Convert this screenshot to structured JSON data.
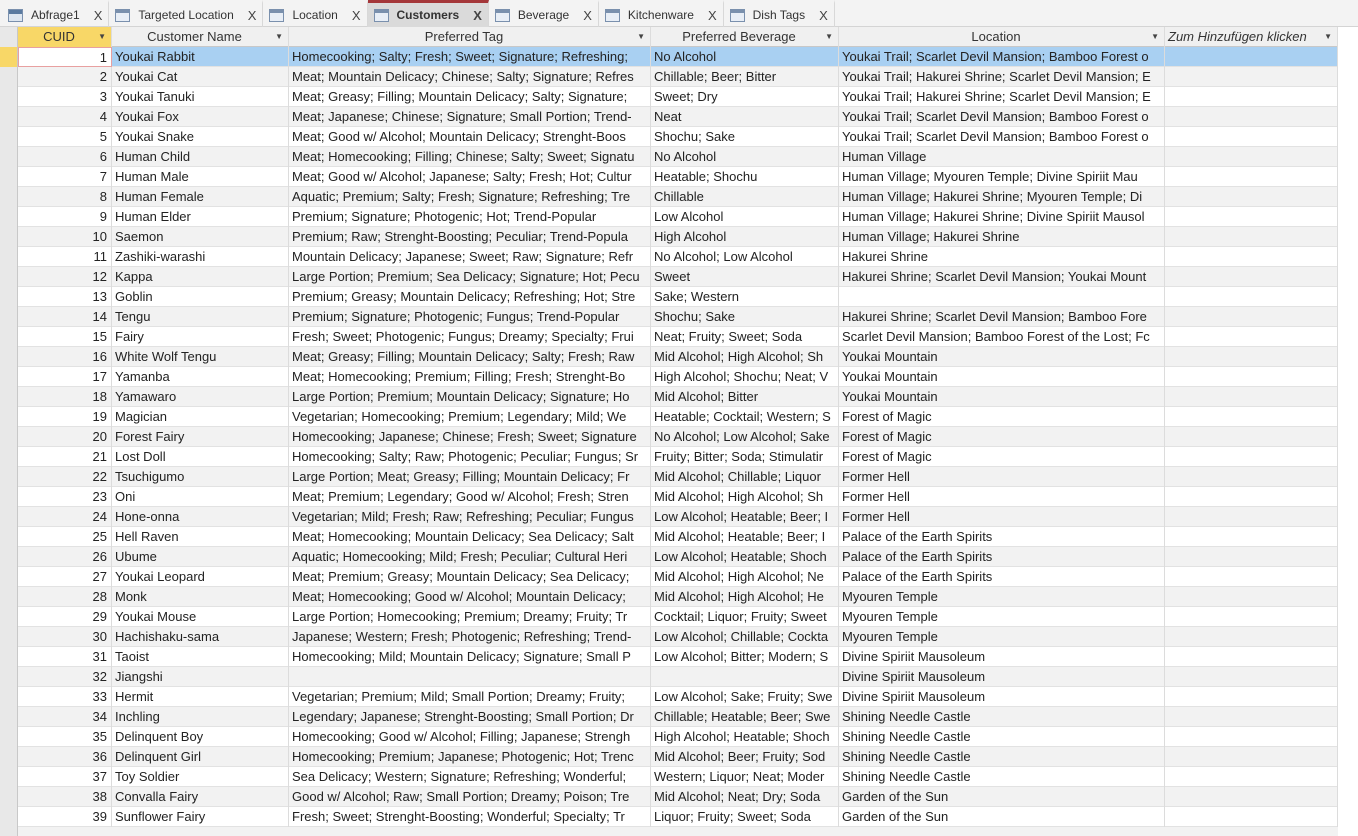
{
  "tabs": [
    {
      "label": "Abfrage1",
      "icon": "query-icon",
      "active": false
    },
    {
      "label": "Targeted Location",
      "icon": "table-icon",
      "active": false
    },
    {
      "label": "Location",
      "icon": "table-icon",
      "active": false
    },
    {
      "label": "Customers",
      "icon": "table-icon",
      "active": true
    },
    {
      "label": "Beverage",
      "icon": "table-icon",
      "active": false
    },
    {
      "label": "Kitchenware",
      "icon": "table-icon",
      "active": false
    },
    {
      "label": "Dish Tags",
      "icon": "table-icon",
      "active": false
    }
  ],
  "close_glyph": "X",
  "columns": [
    "CUID",
    "Customer Name",
    "Preferred Tag",
    "Preferred Beverage",
    "Location",
    "Zum Hinzufügen klicken"
  ],
  "colors": {
    "selected_row": "#a9d0f2",
    "active_header": "#f8d767",
    "active_tab_border": "#a4373a"
  },
  "rows": [
    [
      "1",
      "Youkai Rabbit",
      "Homecooking; Salty; Fresh; Sweet; Signature; Refreshing;",
      "No Alcohol",
      "Youkai Trail; Scarlet Devil Mansion; Bamboo Forest o"
    ],
    [
      "2",
      "Youkai Cat",
      "Meat; Mountain Delicacy; Chinese; Salty; Signature; Refres",
      "Chillable; Beer; Bitter",
      "Youkai Trail; Hakurei Shrine; Scarlet Devil Mansion; E"
    ],
    [
      "3",
      "Youkai Tanuki",
      "Meat; Greasy; Filling; Mountain Delicacy; Salty; Signature;",
      "Sweet; Dry",
      "Youkai Trail; Hakurei Shrine; Scarlet Devil Mansion; E"
    ],
    [
      "4",
      "Youkai Fox",
      "Meat; Japanese; Chinese; Signature; Small Portion; Trend-",
      "Neat",
      "Youkai Trail; Scarlet Devil Mansion; Bamboo Forest o"
    ],
    [
      "5",
      "Youkai Snake",
      "Meat; Good w/ Alcohol; Mountain Delicacy; Strenght-Boos",
      "Shochu; Sake",
      "Youkai Trail; Scarlet Devil Mansion; Bamboo Forest o"
    ],
    [
      "6",
      "Human Child",
      "Meat; Homecooking; Filling; Chinese; Salty; Sweet; Signatu",
      "No Alcohol",
      "Human Village"
    ],
    [
      "7",
      "Human Male",
      "Meat; Good w/ Alcohol; Japanese; Salty; Fresh; Hot; Cultur",
      "Heatable; Shochu",
      "Human Village; Myouren Temple; Divine Spiriit Mau"
    ],
    [
      "8",
      "Human Female",
      "Aquatic; Premium; Salty; Fresh; Signature; Refreshing; Tre",
      "Chillable",
      "Human Village; Hakurei Shrine; Myouren Temple; Di"
    ],
    [
      "9",
      "Human Elder",
      "Premium; Signature; Photogenic; Hot; Trend-Popular",
      "Low Alcohol",
      "Human Village; Hakurei Shrine; Divine Spiriit Mausol"
    ],
    [
      "10",
      "Saemon",
      "Premium; Raw; Strenght-Boosting; Peculiar; Trend-Popula",
      "High Alcohol",
      "Human Village; Hakurei Shrine"
    ],
    [
      "11",
      "Zashiki-warashi",
      "Mountain Delicacy; Japanese; Sweet; Raw; Signature; Refr",
      "No Alcohol; Low Alcohol",
      "Hakurei Shrine"
    ],
    [
      "12",
      "Kappa",
      "Large Portion; Premium; Sea Delicacy; Signature; Hot; Pecu",
      "Sweet",
      "Hakurei Shrine; Scarlet Devil Mansion; Youkai Mount"
    ],
    [
      "13",
      "Goblin",
      "Premium; Greasy; Mountain Delicacy; Refreshing; Hot; Stre",
      "Sake; Western",
      ""
    ],
    [
      "14",
      "Tengu",
      "Premium; Signature; Photogenic; Fungus; Trend-Popular",
      "Shochu; Sake",
      "Hakurei Shrine; Scarlet Devil Mansion; Bamboo Fore"
    ],
    [
      "15",
      "Fairy",
      "Fresh; Sweet; Photogenic; Fungus; Dreamy; Specialty; Frui",
      "Neat; Fruity; Sweet; Soda",
      "Scarlet Devil Mansion; Bamboo Forest of the Lost; Fc"
    ],
    [
      "16",
      "White Wolf Tengu",
      "Meat; Greasy; Filling; Mountain Delicacy; Salty; Fresh; Raw",
      "Mid Alcohol; High Alcohol; Sh",
      "Youkai Mountain"
    ],
    [
      "17",
      "Yamanba",
      "Meat; Homecooking; Premium; Filling; Fresh; Strenght-Bo",
      "High Alcohol; Shochu; Neat; V",
      "Youkai Mountain"
    ],
    [
      "18",
      "Yamawaro",
      "Large Portion; Premium; Mountain Delicacy; Signature; Ho",
      "Mid Alcohol; Bitter",
      "Youkai Mountain"
    ],
    [
      "19",
      "Magician",
      "Vegetarian; Homecooking; Premium; Legendary; Mild; We",
      "Heatable; Cocktail; Western; S",
      "Forest of Magic"
    ],
    [
      "20",
      "Forest Fairy",
      "Homecooking; Japanese; Chinese; Fresh; Sweet; Signature",
      "No Alcohol; Low Alcohol; Sake",
      "Forest of Magic"
    ],
    [
      "21",
      "Lost Doll",
      "Homecooking; Salty; Raw; Photogenic; Peculiar; Fungus; Sr",
      "Fruity; Bitter; Soda; Stimulatir",
      "Forest of Magic"
    ],
    [
      "22",
      "Tsuchigumo",
      "Large Portion; Meat; Greasy; Filling; Mountain Delicacy; Fr",
      "Mid Alcohol; Chillable; Liquor",
      "Former Hell"
    ],
    [
      "23",
      "Oni",
      "Meat; Premium; Legendary; Good w/ Alcohol; Fresh; Stren",
      "Mid Alcohol; High Alcohol; Sh",
      "Former Hell"
    ],
    [
      "24",
      "Hone-onna",
      "Vegetarian; Mild; Fresh; Raw; Refreshing; Peculiar; Fungus",
      "Low Alcohol; Heatable; Beer; I",
      "Former Hell"
    ],
    [
      "25",
      "Hell Raven",
      "Meat; Homecooking; Mountain Delicacy; Sea Delicacy; Salt",
      "Mid Alcohol; Heatable; Beer; I",
      "Palace of the Earth Spirits"
    ],
    [
      "26",
      "Ubume",
      "Aquatic; Homecooking; Mild; Fresh; Peculiar; Cultural Heri",
      "Low Alcohol; Heatable; Shoch",
      "Palace of the Earth Spirits"
    ],
    [
      "27",
      "Youkai Leopard",
      "Meat; Premium; Greasy; Mountain Delicacy; Sea Delicacy;",
      "Mid Alcohol; High Alcohol; Ne",
      "Palace of the Earth Spirits"
    ],
    [
      "28",
      "Monk",
      "Meat; Homecooking; Good w/ Alcohol; Mountain Delicacy;",
      "Mid Alcohol; High Alcohol; He",
      "Myouren Temple"
    ],
    [
      "29",
      "Youkai Mouse",
      "Large Portion; Homecooking; Premium; Dreamy; Fruity; Tr",
      "Cocktail; Liquor; Fruity; Sweet",
      "Myouren Temple"
    ],
    [
      "30",
      "Hachishaku-sama",
      "Japanese; Western; Fresh; Photogenic; Refreshing; Trend-",
      "Low Alcohol; Chillable; Cockta",
      "Myouren Temple"
    ],
    [
      "31",
      "Taoist",
      "Homecooking; Mild; Mountain Delicacy; Signature; Small P",
      "Low Alcohol; Bitter; Modern; S",
      "Divine Spiriit Mausoleum"
    ],
    [
      "32",
      "Jiangshi",
      "",
      "",
      "Divine Spiriit Mausoleum"
    ],
    [
      "33",
      "Hermit",
      "Vegetarian; Premium; Mild; Small Portion; Dreamy; Fruity;",
      "Low Alcohol; Sake; Fruity; Swe",
      "Divine Spiriit Mausoleum"
    ],
    [
      "34",
      "Inchling",
      "Legendary; Japanese; Strenght-Boosting; Small Portion; Dr",
      "Chillable; Heatable; Beer; Swe",
      "Shining Needle Castle"
    ],
    [
      "35",
      "Delinquent Boy",
      "Homecooking; Good w/ Alcohol; Filling; Japanese; Strengh",
      "High Alcohol; Heatable; Shoch",
      "Shining Needle Castle"
    ],
    [
      "36",
      "Delinquent Girl",
      "Homecooking; Premium; Japanese; Photogenic; Hot; Trenc",
      "Mid Alcohol; Beer; Fruity; Sod",
      "Shining Needle Castle"
    ],
    [
      "37",
      "Toy Soldier",
      "Sea Delicacy; Western; Signature; Refreshing; Wonderful;",
      "Western; Liquor; Neat; Moder",
      "Shining Needle Castle"
    ],
    [
      "38",
      "Convalla Fairy",
      "Good w/ Alcohol; Raw; Small Portion; Dreamy; Poison; Tre",
      "Mid Alcohol; Neat; Dry; Soda",
      "Garden of the Sun"
    ],
    [
      "39",
      "Sunflower Fairy",
      "Fresh; Sweet; Strenght-Boosting; Wonderful; Specialty; Tr",
      "Liquor; Fruity; Sweet; Soda",
      "Garden of the Sun"
    ]
  ]
}
